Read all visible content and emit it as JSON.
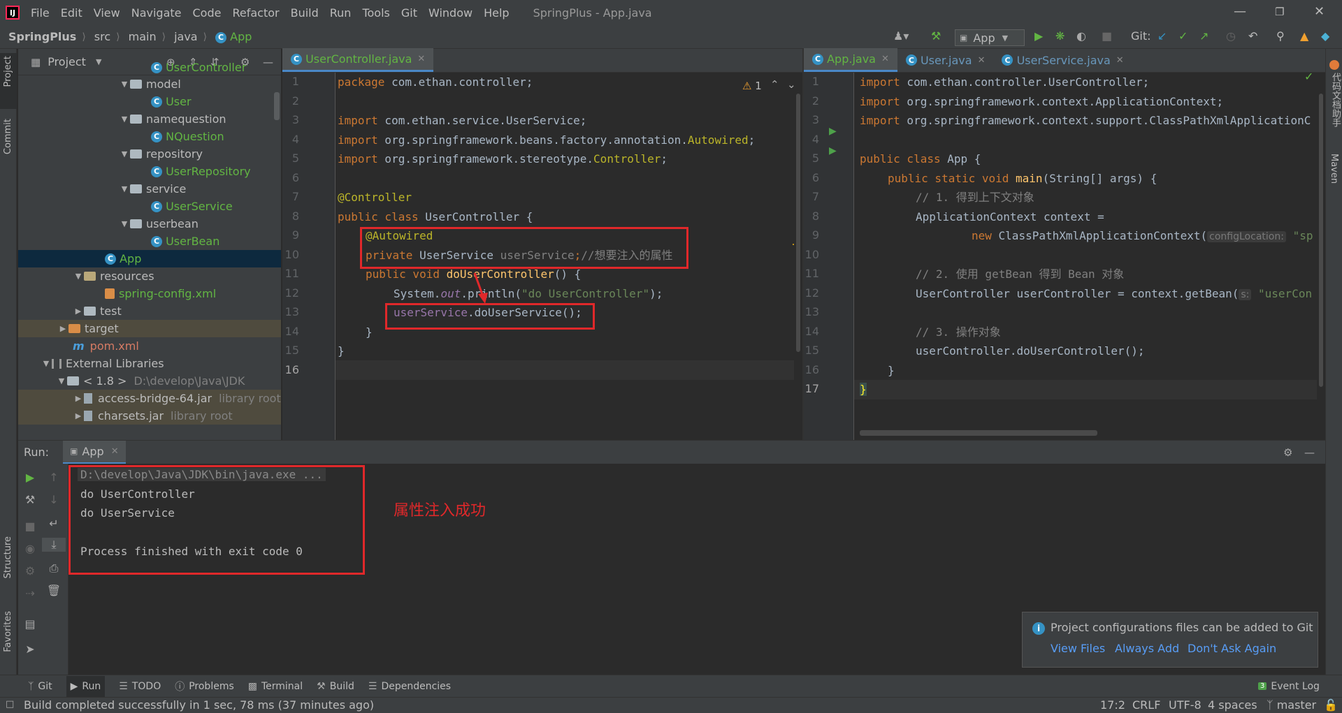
{
  "window": {
    "title": "SpringPlus - App.java",
    "menu": [
      "File",
      "Edit",
      "View",
      "Navigate",
      "Code",
      "Refactor",
      "Build",
      "Run",
      "Tools",
      "Git",
      "Window",
      "Help"
    ]
  },
  "navbar": {
    "breadcrumb": [
      "SpringPlus",
      "src",
      "main",
      "java",
      "App"
    ],
    "run_config": "App",
    "git_label": "Git:"
  },
  "left_stripe": {
    "project": "Project",
    "commit": "Commit",
    "structure": "Structure",
    "favorites": "Favorites"
  },
  "right_stripe": {
    "docs": "代码文档助手",
    "maven": "Maven"
  },
  "project_panel": {
    "title": "Project",
    "rows": [
      {
        "label": "UserController",
        "kind": "class"
      },
      {
        "label": "model",
        "kind": "package"
      },
      {
        "label": "User",
        "kind": "class"
      },
      {
        "label": "namequestion",
        "kind": "package"
      },
      {
        "label": "NQuestion",
        "kind": "class"
      },
      {
        "label": "repository",
        "kind": "package"
      },
      {
        "label": "UserRepository",
        "kind": "class"
      },
      {
        "label": "service",
        "kind": "package"
      },
      {
        "label": "UserService",
        "kind": "class"
      },
      {
        "label": "userbean",
        "kind": "package"
      },
      {
        "label": "UserBean",
        "kind": "class"
      },
      {
        "label": "App",
        "kind": "class-selected"
      },
      {
        "label": "resources",
        "kind": "folder"
      },
      {
        "label": "spring-config.xml",
        "kind": "xml"
      },
      {
        "label": "test",
        "kind": "folder"
      },
      {
        "label": "target",
        "kind": "folder"
      },
      {
        "label": "pom.xml",
        "kind": "pom"
      },
      {
        "label": "External Libraries",
        "kind": "libs"
      },
      {
        "label": "< 1.8 >",
        "kind": "jdk",
        "extra": "D:\\develop\\Java\\JDK"
      },
      {
        "label": "access-bridge-64.jar",
        "kind": "jar",
        "extra": "library root"
      },
      {
        "label": "charsets.jar",
        "kind": "jar",
        "extra": "library root"
      }
    ]
  },
  "left_editor": {
    "tabs": [
      "UserController.java"
    ],
    "warning_count": "1",
    "lines": [
      "1",
      "2",
      "3",
      "4",
      "5",
      "6",
      "7",
      "8",
      "9",
      "10",
      "11",
      "12",
      "13",
      "14",
      "15",
      "16"
    ],
    "code": {
      "l1_kw": "package",
      "l1_rest": " com.ethan.controller;",
      "l3_kw": "import",
      "l3_rest": " com.ethan.service.UserService;",
      "l4_kw": "import",
      "l4_rest": " org.springframework.beans.factory.annotation.",
      "l4_ann": "Autowired",
      "l4_end": ";",
      "l5_kw": "import",
      "l5_rest": " org.springframework.stereotype.",
      "l5_ann": "Controller",
      "l5_end": ";",
      "l7_ann": "@Controller",
      "l8_kw": "public class",
      "l8_rest": " UserController {",
      "l9_ann": "@Autowired",
      "l10_kw": "private",
      "l10_rest": " UserService ",
      "l10_fld": "userService",
      "l10_end": ";",
      "l10_cm": "//想要注入的属性",
      "l11_kw": "public void",
      "l11_fn": " doUserController",
      "l11_rest": "() {",
      "l12_a": "System.",
      "l12_st": "out",
      "l12_b": ".println(",
      "l12_str": "\"do UserController\"",
      "l12_c": ");",
      "l13_fld": "userService",
      "l13_rest": ".doUserService();",
      "l14": "}",
      "l15": "}"
    }
  },
  "right_editor": {
    "tabs": [
      "App.java",
      "User.java",
      "UserService.java"
    ],
    "lines": [
      "1",
      "2",
      "3",
      "4",
      "5",
      "6",
      "7",
      "8",
      "9",
      "10",
      "11",
      "12",
      "13",
      "14",
      "15",
      "16",
      "17"
    ],
    "code": {
      "l1_kw": "import",
      "l1_rest": " com.ethan.controller.UserController;",
      "l2_kw": "import",
      "l2_rest": " org.springframework.context.ApplicationContext;",
      "l3_kw": "import",
      "l3_rest": " org.springframework.context.support.ClassPathXmlApplicationC",
      "l5_kw": "public class",
      "l5_rest": " App {",
      "l6_kw": "public static void",
      "l6_fn": " main",
      "l6_rest": "(String[] args) {",
      "l7_cm": "// 1. 得到上下文对象",
      "l8": "ApplicationContext context =",
      "l9_kw": "new",
      "l9_rest": " ClassPathXmlApplicationContext(",
      "l9_hint": "configLocation:",
      "l9_str": " \"sp",
      "l11_cm": "// 2. 使用 getBean 得到 Bean 对象",
      "l12_rest": "UserController userController = context.getBean(",
      "l12_hint": "s:",
      "l12_str": " \"userCon",
      "l14_cm": "// 3. 操作对象",
      "l15": "userController.doUserController();",
      "l16": "}",
      "l17": "}"
    }
  },
  "run_panel": {
    "label": "Run:",
    "tab": "App",
    "output": [
      "D:\\develop\\Java\\JDK\\bin\\java.exe ...",
      "do UserController",
      "do UserService",
      "Process finished with exit code 0"
    ],
    "annotation": "属性注入成功"
  },
  "notification": {
    "message": "Project configurations files can be added to Git",
    "links": [
      "View Files",
      "Always Add",
      "Don't Ask Again"
    ]
  },
  "bottom_tools": [
    "Git",
    "Run",
    "TODO",
    "Problems",
    "Terminal",
    "Build",
    "Dependencies"
  ],
  "event_log": {
    "count": "3",
    "label": "Event Log"
  },
  "status": {
    "message": "Build completed successfully in 1 sec, 78 ms (37 minutes ago)",
    "position": "17:2",
    "line_sep": "CRLF",
    "encoding": "UTF-8",
    "indent": "4 spaces",
    "branch": "master"
  },
  "colors": {
    "accent": "#4a88c7",
    "highlight": "#e0282a",
    "link": "#589df6",
    "green": "#62b543"
  }
}
